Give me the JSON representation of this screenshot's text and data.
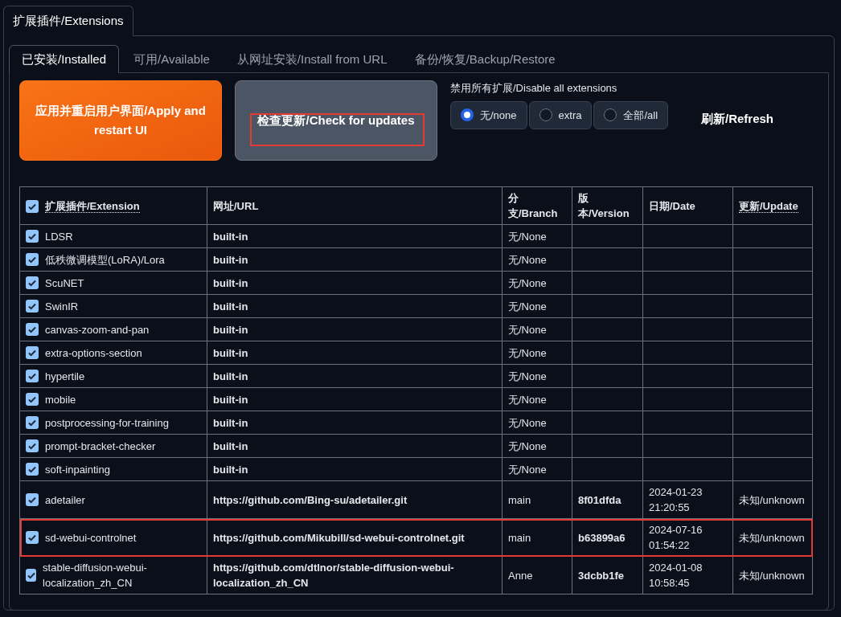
{
  "main_tab": {
    "label": "扩展插件/Extensions",
    "selected": true
  },
  "tabs": [
    {
      "label": "已安装/Installed",
      "selected": true
    },
    {
      "label": "可用/Available",
      "selected": false
    },
    {
      "label": "从网址安装/Install from URL",
      "selected": false
    },
    {
      "label": "备份/恢复/Backup/Restore",
      "selected": false
    }
  ],
  "apply_button": {
    "label": "应用并重启用户界面/Apply and restart UI"
  },
  "check_button": {
    "label": "检查更新/Check for updates",
    "highlighted": true
  },
  "disable_group": {
    "label": "禁用所有扩展/Disable all extensions",
    "options": [
      {
        "label": "无/none",
        "selected": true
      },
      {
        "label": "extra",
        "selected": false
      },
      {
        "label": "全部/all",
        "selected": false
      }
    ]
  },
  "refresh_button": {
    "label": "刷新/Refresh"
  },
  "table": {
    "select_all_checked": true,
    "columns": [
      "扩展插件/Extension",
      "网址/URL",
      "分支/Branch",
      "版本/Version",
      "日期/Date",
      "更新/Update"
    ],
    "rows": [
      {
        "checked": true,
        "highlighted": false,
        "name": "LDSR",
        "url": "built-in",
        "branch": "无/None",
        "version": "",
        "date": "",
        "update": ""
      },
      {
        "checked": true,
        "highlighted": false,
        "name": "低秩微调模型(LoRA)/Lora",
        "url": "built-in",
        "branch": "无/None",
        "version": "",
        "date": "",
        "update": ""
      },
      {
        "checked": true,
        "highlighted": false,
        "name": "ScuNET",
        "url": "built-in",
        "branch": "无/None",
        "version": "",
        "date": "",
        "update": ""
      },
      {
        "checked": true,
        "highlighted": false,
        "name": "SwinIR",
        "url": "built-in",
        "branch": "无/None",
        "version": "",
        "date": "",
        "update": ""
      },
      {
        "checked": true,
        "highlighted": false,
        "name": "canvas-zoom-and-pan",
        "url": "built-in",
        "branch": "无/None",
        "version": "",
        "date": "",
        "update": ""
      },
      {
        "checked": true,
        "highlighted": false,
        "name": "extra-options-section",
        "url": "built-in",
        "branch": "无/None",
        "version": "",
        "date": "",
        "update": ""
      },
      {
        "checked": true,
        "highlighted": false,
        "name": "hypertile",
        "url": "built-in",
        "branch": "无/None",
        "version": "",
        "date": "",
        "update": ""
      },
      {
        "checked": true,
        "highlighted": false,
        "name": "mobile",
        "url": "built-in",
        "branch": "无/None",
        "version": "",
        "date": "",
        "update": ""
      },
      {
        "checked": true,
        "highlighted": false,
        "name": "postprocessing-for-training",
        "url": "built-in",
        "branch": "无/None",
        "version": "",
        "date": "",
        "update": ""
      },
      {
        "checked": true,
        "highlighted": false,
        "name": "prompt-bracket-checker",
        "url": "built-in",
        "branch": "无/None",
        "version": "",
        "date": "",
        "update": ""
      },
      {
        "checked": true,
        "highlighted": false,
        "name": "soft-inpainting",
        "url": "built-in",
        "branch": "无/None",
        "version": "",
        "date": "",
        "update": ""
      },
      {
        "checked": true,
        "highlighted": false,
        "name": "adetailer",
        "url": "https://github.com/Bing-su/adetailer.git",
        "branch": "main",
        "version": "8f01dfda",
        "date": "2024-01-23 21:20:55",
        "update": "未知/unknown"
      },
      {
        "checked": true,
        "highlighted": true,
        "name": "sd-webui-controlnet",
        "url": "https://github.com/Mikubill/sd-webui-controlnet.git",
        "branch": "main",
        "version": "b63899a6",
        "date": "2024-07-16 01:54:22",
        "update": "未知/unknown"
      },
      {
        "checked": true,
        "highlighted": false,
        "name": "stable-diffusion-webui-localization_zh_CN",
        "url": "https://github.com/dtlnor/stable-diffusion-webui-localization_zh_CN",
        "branch": "Anne",
        "version": "3dcbb1fe",
        "date": "2024-01-08 10:58:45",
        "update": "未知/unknown"
      }
    ]
  }
}
